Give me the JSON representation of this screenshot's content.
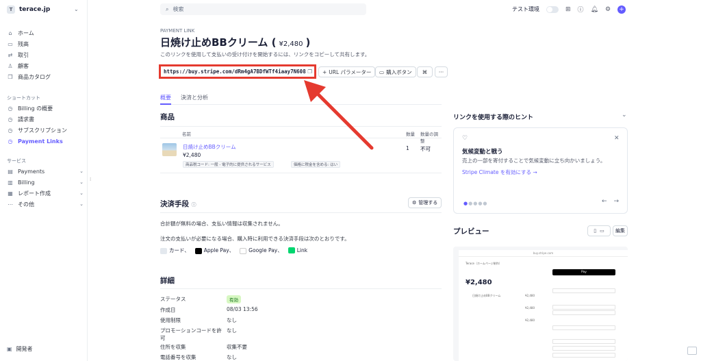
{
  "account": {
    "avatar_letter": "T",
    "name": "terace.jp"
  },
  "sidebar": {
    "main": [
      {
        "icon": "home-icon",
        "glyph": "⌂",
        "label": "ホーム"
      },
      {
        "icon": "balance-icon",
        "glyph": "▭",
        "label": "残高"
      },
      {
        "icon": "transactions-icon",
        "glyph": "⇄",
        "label": "取引"
      },
      {
        "icon": "customers-icon",
        "glyph": "♙",
        "label": "顧客"
      },
      {
        "icon": "catalog-icon",
        "glyph": "❒",
        "label": "商品カタログ"
      }
    ],
    "shortcuts_label": "ショートカット",
    "shortcuts": [
      {
        "icon": "clock-icon",
        "glyph": "◷",
        "label": "Billing の概要"
      },
      {
        "icon": "clock-icon",
        "glyph": "◷",
        "label": "請求書"
      },
      {
        "icon": "clock-icon",
        "glyph": "◷",
        "label": "サブスクリプション"
      },
      {
        "icon": "clock-icon",
        "glyph": "◷",
        "label": "Payment Links"
      }
    ],
    "services_label": "サービス",
    "services": [
      {
        "icon": "payments-icon",
        "glyph": "▤",
        "label": "Payments"
      },
      {
        "icon": "billing-icon",
        "glyph": "▥",
        "label": "Billing"
      },
      {
        "icon": "reports-icon",
        "glyph": "▦",
        "label": "レポート作成"
      },
      {
        "icon": "more-icon",
        "glyph": "⋯",
        "label": "その他"
      }
    ],
    "developer": "開発者"
  },
  "topbar": {
    "search_placeholder": "検索",
    "test_mode": "テスト環境"
  },
  "page": {
    "eyebrow": "PAYMENT LINK",
    "title": "日焼け止めBBクリーム (",
    "price": "¥2,480",
    "title_close": ")",
    "subtitle": "このリンクを使用して支払いの受け付けを開始するには、リンクをコピーして共有します。",
    "url": "https://buy.stripe.com/dRm4gA7BDfWTf4iaay7N608",
    "url_params": "URL パラメーター",
    "buy_button": "購入ボタン",
    "more": "···"
  },
  "tabs": [
    "概要",
    "決済と分析"
  ],
  "products": {
    "heading": "商品",
    "col_name": "名前",
    "col_qty": "数量",
    "col_adjust": "数量の調整",
    "item": {
      "name": "日焼け止めBBクリーム",
      "price": "¥2,480",
      "tag1": "商品税コード: 一般 - 電子的に提供されるサービス",
      "tag2": "価格に税金を含める: はい",
      "qty": "1",
      "adjust": "不可"
    }
  },
  "payment": {
    "heading": "決済手段",
    "manage": "管理する",
    "line1": "合計額が無料の場合、支払い情報は収集されません。",
    "line2": "注文の支払いが必要になる場合、購入時に利用できる決済手段は次のとおりです。",
    "methods": [
      "カード、",
      "Apple Pay、",
      "Google Pay、",
      "Link"
    ]
  },
  "details": {
    "heading": "詳細",
    "rows": [
      {
        "label": "ステータス",
        "value": "有効"
      },
      {
        "label": "作成日",
        "value": "08/03 13:56"
      },
      {
        "label": "使用制限",
        "value": "なし"
      },
      {
        "label": "プロモーションコードを許可",
        "value": "なし"
      },
      {
        "label": "住所を収集",
        "value": "収集不要"
      },
      {
        "label": "電話番号を収集",
        "value": "なし"
      }
    ]
  },
  "hints": {
    "heading": "リンクを使用する際のヒント",
    "card_title": "気候変動と戦う",
    "card_desc": "売上の一部を寄付することで気候変動に立ち向かいましょう。",
    "card_link": "Stripe Climate を有効にする →"
  },
  "preview": {
    "heading": "プレビュー",
    "edit": "編集",
    "store": "Terace（ホームページ制作）",
    "amount": "¥2,480",
    "item": "日焼け止めBBクリーム",
    "item_price": "¥2,480",
    "pay": " Pay",
    "domain": "buy.stripe.com"
  }
}
